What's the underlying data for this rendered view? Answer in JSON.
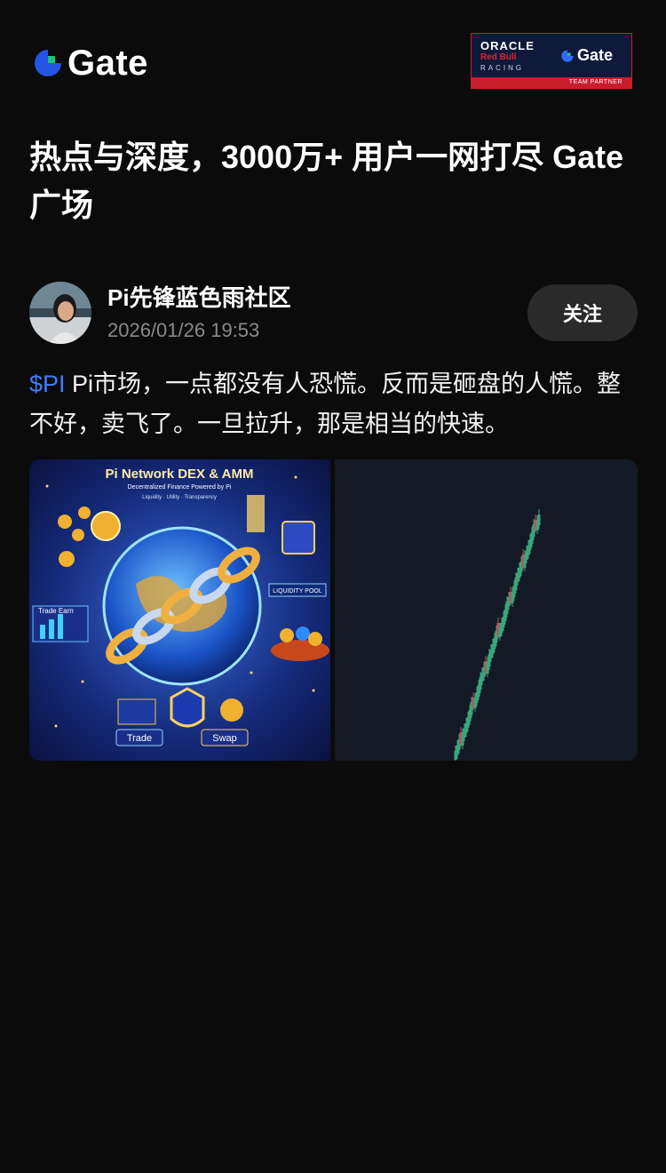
{
  "brand": {
    "name": "Gate"
  },
  "partner": {
    "line1": "ORACLE",
    "line2": "Red Bull",
    "line3": "RACING",
    "brand": "Gate",
    "badge": "TEAM PARTNER"
  },
  "headline": "热点与深度，3000万+ 用户一网打尽 Gate 广场",
  "post": {
    "author": "Pi先锋蓝色雨社区",
    "timestamp": "2026/01/26 19:53",
    "follow_label": "关注",
    "ticker": "$PI",
    "text": " Pi市场，一点都没有人恐慌。反而是砸盘的人慌。整不好，卖飞了。一旦拉升，那是相当的快速。"
  },
  "images": {
    "poster": {
      "title": "Pi Network DEX & AMM",
      "subtitle": "Decentralized Finance Powered by Pi",
      "tags": "Liquidity · Utility · Transparency",
      "pool_label": "LIQUIDITY POOL",
      "trade_earn": "Trade  Earn",
      "trade_label": "Trade",
      "swap_label": "Swap"
    }
  },
  "colors": {
    "background": "#0b0b0b",
    "tag": "#3f7cff",
    "muted": "#8a8a8a",
    "follow_bg": "#2a2a2a",
    "candle_up": "#3aa57a",
    "candle_down": "#c44b5a"
  }
}
